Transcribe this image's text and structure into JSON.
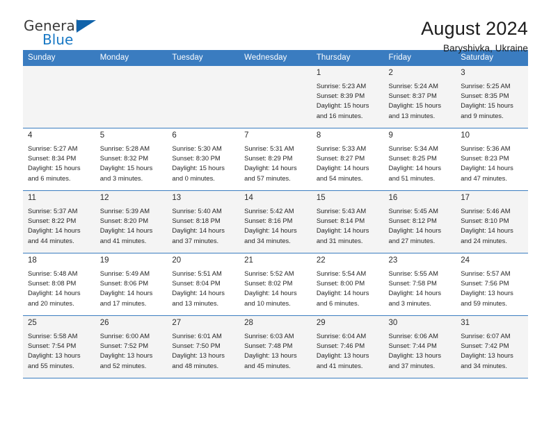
{
  "brand": {
    "name_part1": "General",
    "name_part2": "Blue",
    "accent_color": "#1878c4",
    "triangle_color": "#1163aa"
  },
  "header": {
    "title": "August 2024",
    "subtitle": "Baryshivka, Ukraine"
  },
  "calendar": {
    "header_bg": "#3a7cc0",
    "weekday_headers": [
      "Sunday",
      "Monday",
      "Tuesday",
      "Wednesday",
      "Thursday",
      "Friday",
      "Saturday"
    ],
    "labels": {
      "sunrise": "Sunrise:",
      "sunset": "Sunset:",
      "daylight": "Daylight:"
    },
    "weeks": [
      [
        {
          "day": "",
          "sunrise": "",
          "sunset": "",
          "daylight_line1": "",
          "daylight_line2": ""
        },
        {
          "day": "",
          "sunrise": "",
          "sunset": "",
          "daylight_line1": "",
          "daylight_line2": ""
        },
        {
          "day": "",
          "sunrise": "",
          "sunset": "",
          "daylight_line1": "",
          "daylight_line2": ""
        },
        {
          "day": "",
          "sunrise": "",
          "sunset": "",
          "daylight_line1": "",
          "daylight_line2": ""
        },
        {
          "day": "1",
          "sunrise": "Sunrise: 5:23 AM",
          "sunset": "Sunset: 8:39 PM",
          "daylight_line1": "Daylight: 15 hours",
          "daylight_line2": "and 16 minutes."
        },
        {
          "day": "2",
          "sunrise": "Sunrise: 5:24 AM",
          "sunset": "Sunset: 8:37 PM",
          "daylight_line1": "Daylight: 15 hours",
          "daylight_line2": "and 13 minutes."
        },
        {
          "day": "3",
          "sunrise": "Sunrise: 5:25 AM",
          "sunset": "Sunset: 8:35 PM",
          "daylight_line1": "Daylight: 15 hours",
          "daylight_line2": "and 9 minutes."
        }
      ],
      [
        {
          "day": "4",
          "sunrise": "Sunrise: 5:27 AM",
          "sunset": "Sunset: 8:34 PM",
          "daylight_line1": "Daylight: 15 hours",
          "daylight_line2": "and 6 minutes."
        },
        {
          "day": "5",
          "sunrise": "Sunrise: 5:28 AM",
          "sunset": "Sunset: 8:32 PM",
          "daylight_line1": "Daylight: 15 hours",
          "daylight_line2": "and 3 minutes."
        },
        {
          "day": "6",
          "sunrise": "Sunrise: 5:30 AM",
          "sunset": "Sunset: 8:30 PM",
          "daylight_line1": "Daylight: 15 hours",
          "daylight_line2": "and 0 minutes."
        },
        {
          "day": "7",
          "sunrise": "Sunrise: 5:31 AM",
          "sunset": "Sunset: 8:29 PM",
          "daylight_line1": "Daylight: 14 hours",
          "daylight_line2": "and 57 minutes."
        },
        {
          "day": "8",
          "sunrise": "Sunrise: 5:33 AM",
          "sunset": "Sunset: 8:27 PM",
          "daylight_line1": "Daylight: 14 hours",
          "daylight_line2": "and 54 minutes."
        },
        {
          "day": "9",
          "sunrise": "Sunrise: 5:34 AM",
          "sunset": "Sunset: 8:25 PM",
          "daylight_line1": "Daylight: 14 hours",
          "daylight_line2": "and 51 minutes."
        },
        {
          "day": "10",
          "sunrise": "Sunrise: 5:36 AM",
          "sunset": "Sunset: 8:23 PM",
          "daylight_line1": "Daylight: 14 hours",
          "daylight_line2": "and 47 minutes."
        }
      ],
      [
        {
          "day": "11",
          "sunrise": "Sunrise: 5:37 AM",
          "sunset": "Sunset: 8:22 PM",
          "daylight_line1": "Daylight: 14 hours",
          "daylight_line2": "and 44 minutes."
        },
        {
          "day": "12",
          "sunrise": "Sunrise: 5:39 AM",
          "sunset": "Sunset: 8:20 PM",
          "daylight_line1": "Daylight: 14 hours",
          "daylight_line2": "and 41 minutes."
        },
        {
          "day": "13",
          "sunrise": "Sunrise: 5:40 AM",
          "sunset": "Sunset: 8:18 PM",
          "daylight_line1": "Daylight: 14 hours",
          "daylight_line2": "and 37 minutes."
        },
        {
          "day": "14",
          "sunrise": "Sunrise: 5:42 AM",
          "sunset": "Sunset: 8:16 PM",
          "daylight_line1": "Daylight: 14 hours",
          "daylight_line2": "and 34 minutes."
        },
        {
          "day": "15",
          "sunrise": "Sunrise: 5:43 AM",
          "sunset": "Sunset: 8:14 PM",
          "daylight_line1": "Daylight: 14 hours",
          "daylight_line2": "and 31 minutes."
        },
        {
          "day": "16",
          "sunrise": "Sunrise: 5:45 AM",
          "sunset": "Sunset: 8:12 PM",
          "daylight_line1": "Daylight: 14 hours",
          "daylight_line2": "and 27 minutes."
        },
        {
          "day": "17",
          "sunrise": "Sunrise: 5:46 AM",
          "sunset": "Sunset: 8:10 PM",
          "daylight_line1": "Daylight: 14 hours",
          "daylight_line2": "and 24 minutes."
        }
      ],
      [
        {
          "day": "18",
          "sunrise": "Sunrise: 5:48 AM",
          "sunset": "Sunset: 8:08 PM",
          "daylight_line1": "Daylight: 14 hours",
          "daylight_line2": "and 20 minutes."
        },
        {
          "day": "19",
          "sunrise": "Sunrise: 5:49 AM",
          "sunset": "Sunset: 8:06 PM",
          "daylight_line1": "Daylight: 14 hours",
          "daylight_line2": "and 17 minutes."
        },
        {
          "day": "20",
          "sunrise": "Sunrise: 5:51 AM",
          "sunset": "Sunset: 8:04 PM",
          "daylight_line1": "Daylight: 14 hours",
          "daylight_line2": "and 13 minutes."
        },
        {
          "day": "21",
          "sunrise": "Sunrise: 5:52 AM",
          "sunset": "Sunset: 8:02 PM",
          "daylight_line1": "Daylight: 14 hours",
          "daylight_line2": "and 10 minutes."
        },
        {
          "day": "22",
          "sunrise": "Sunrise: 5:54 AM",
          "sunset": "Sunset: 8:00 PM",
          "daylight_line1": "Daylight: 14 hours",
          "daylight_line2": "and 6 minutes."
        },
        {
          "day": "23",
          "sunrise": "Sunrise: 5:55 AM",
          "sunset": "Sunset: 7:58 PM",
          "daylight_line1": "Daylight: 14 hours",
          "daylight_line2": "and 3 minutes."
        },
        {
          "day": "24",
          "sunrise": "Sunrise: 5:57 AM",
          "sunset": "Sunset: 7:56 PM",
          "daylight_line1": "Daylight: 13 hours",
          "daylight_line2": "and 59 minutes."
        }
      ],
      [
        {
          "day": "25",
          "sunrise": "Sunrise: 5:58 AM",
          "sunset": "Sunset: 7:54 PM",
          "daylight_line1": "Daylight: 13 hours",
          "daylight_line2": "and 55 minutes."
        },
        {
          "day": "26",
          "sunrise": "Sunrise: 6:00 AM",
          "sunset": "Sunset: 7:52 PM",
          "daylight_line1": "Daylight: 13 hours",
          "daylight_line2": "and 52 minutes."
        },
        {
          "day": "27",
          "sunrise": "Sunrise: 6:01 AM",
          "sunset": "Sunset: 7:50 PM",
          "daylight_line1": "Daylight: 13 hours",
          "daylight_line2": "and 48 minutes."
        },
        {
          "day": "28",
          "sunrise": "Sunrise: 6:03 AM",
          "sunset": "Sunset: 7:48 PM",
          "daylight_line1": "Daylight: 13 hours",
          "daylight_line2": "and 45 minutes."
        },
        {
          "day": "29",
          "sunrise": "Sunrise: 6:04 AM",
          "sunset": "Sunset: 7:46 PM",
          "daylight_line1": "Daylight: 13 hours",
          "daylight_line2": "and 41 minutes."
        },
        {
          "day": "30",
          "sunrise": "Sunrise: 6:06 AM",
          "sunset": "Sunset: 7:44 PM",
          "daylight_line1": "Daylight: 13 hours",
          "daylight_line2": "and 37 minutes."
        },
        {
          "day": "31",
          "sunrise": "Sunrise: 6:07 AM",
          "sunset": "Sunset: 7:42 PM",
          "daylight_line1": "Daylight: 13 hours",
          "daylight_line2": "and 34 minutes."
        }
      ]
    ]
  }
}
